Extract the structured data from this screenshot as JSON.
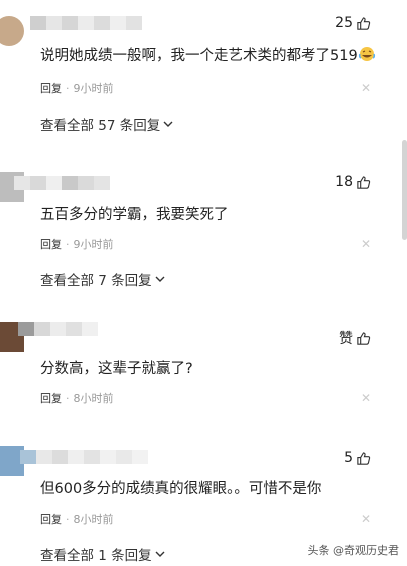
{
  "comments": [
    {
      "likes": "25",
      "text": "说明她成绩一般啊，我一个走艺术类的都考了519",
      "emoji_icon": "laughing-tears-emoji-icon",
      "reply_label": "回复",
      "time": "9小时前",
      "view_all": "查看全部 57 条回复"
    },
    {
      "likes": "18",
      "text": "五百多分的学霸，我要笑死了",
      "reply_label": "回复",
      "time": "9小时前",
      "view_all": "查看全部 7 条回复"
    },
    {
      "likes": "赞",
      "text": "分数高，这辈子就赢了?",
      "reply_label": "回复",
      "time": "8小时前"
    },
    {
      "likes": "5",
      "text": "但600多分的成绩真的很耀眼。。可惜不是你",
      "reply_label": "回复",
      "time": "8小时前",
      "view_all": "查看全部 1 条回复"
    }
  ],
  "icons": {
    "like": "thumbs-up-icon",
    "expand": "chevron-down-icon",
    "close": "close-icon"
  },
  "watermark": "头条 @奇观历史君",
  "colors": {
    "text": "#222222",
    "meta": "#999999",
    "close": "#cccccc"
  }
}
